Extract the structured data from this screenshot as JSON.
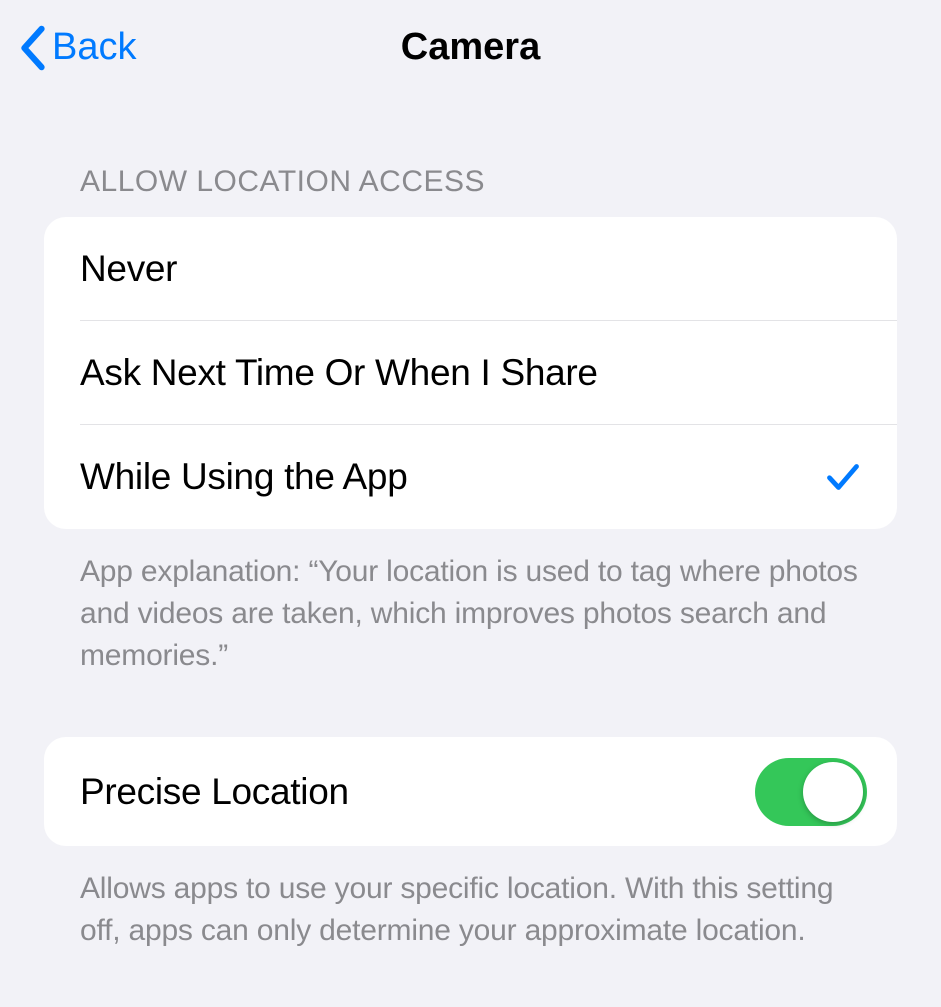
{
  "header": {
    "back_label": "Back",
    "title": "Camera"
  },
  "sections": {
    "location_access": {
      "header": "ALLOW LOCATION ACCESS",
      "options": {
        "never": {
          "label": "Never",
          "selected": false
        },
        "ask": {
          "label": "Ask Next Time Or When I Share",
          "selected": false
        },
        "while_using": {
          "label": "While Using the App",
          "selected": true
        }
      },
      "footer": "App explanation: “Your location is used to tag where photos and videos are taken, which improves photos search and memories.”"
    },
    "precise": {
      "label": "Precise Location",
      "enabled": true,
      "footer": "Allows apps to use your specific location. With this setting off, apps can only determine your approximate location."
    }
  }
}
